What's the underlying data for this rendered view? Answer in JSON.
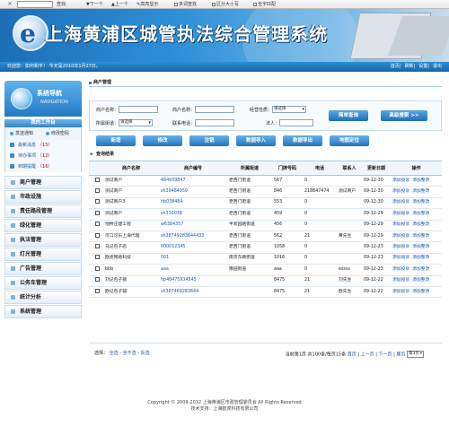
{
  "findbar": {
    "close_glyph": "×",
    "find_label": "查找:",
    "next_label": "下一个",
    "prev_label": "上一个",
    "highlight_label": "高亮显示",
    "multi_label": "多词查找",
    "case_label": "区分大小写",
    "whole_label": "全字匹配"
  },
  "header": {
    "logo_glyph": "e",
    "title": "上海黄浦区城管执法综合管理系统",
    "welcome": "欢迎您：如何和平！ 今天是2010年1月27日。",
    "links": [
      "首页",
      "刷新",
      "设置",
      "退出"
    ]
  },
  "sidebar": {
    "nav_title": "系统导航",
    "nav_subtitle": "NAVIGATION",
    "mywork_title": "我的工作台",
    "shortcuts": [
      "发送通知",
      "修改密码"
    ],
    "tasks": [
      {
        "label": "最新消息",
        "count": "（15）"
      },
      {
        "label": "待办事项",
        "count": "（12）"
      },
      {
        "label": "到期提醒",
        "count": "（16）"
      }
    ],
    "modules": [
      "商户管理",
      "市政设施",
      "责任路段管理",
      "绿化管理",
      "执法管理",
      "灯光管理",
      "广告管理",
      "公务车管理",
      "统计分析",
      "系统管理"
    ]
  },
  "main": {
    "breadcrumb": "商户管理",
    "search": {
      "merchant_name_label": "商户名称：",
      "merchant_no_label": "商户名称：",
      "street_label": "经营性质：",
      "street_value": "请选择",
      "street2_label": "所属街道：",
      "street2_value": "请选择",
      "contact_phone_label": "联系电话：",
      "legal_label": "法人：",
      "query_btn": "简单查询",
      "advanced_btn": "高级搜索 >>"
    },
    "toolbar": [
      "新增",
      "修改",
      "注销",
      "数据导入",
      "数据导出",
      "地图定位"
    ],
    "result_title": "查询结果",
    "columns": [
      "",
      "商户名称",
      "商户编号",
      "所属街道",
      "门牌号码",
      "电话",
      "联系人",
      "更新日期",
      "操作"
    ],
    "op_labels": [
      "添加投诉",
      "添加整改"
    ],
    "rows": [
      [
        "测试商户",
        "484939847",
        "老西门街道",
        "567",
        "0",
        "",
        "09-12-30"
      ],
      [
        "测试商户",
        "sh30484959",
        "老西门街道",
        "846",
        "218847474",
        "测试商户",
        "09-12-30"
      ],
      [
        "测试商户3",
        "hb038484",
        "老西门街道",
        "553",
        "0",
        "",
        "09-12-30"
      ],
      [
        "测试商户",
        "sh330038",
        "老西门街道",
        "459",
        "0",
        "",
        "09-12-29"
      ],
      [
        "地桥庄建工程",
        "w6384357",
        "半淞园路街道",
        "456",
        "0",
        "",
        "09-12-29"
      ],
      [
        "可口可乐上海代理",
        "sh38749283644433",
        "老西门街道",
        "562",
        "21",
        "黄先生",
        "09-12-29"
      ],
      [
        "马记包子店",
        "000012345",
        "老西门街道",
        "1058",
        "0",
        "",
        "09-12-23"
      ],
      [
        "欧虎网络科技",
        "001",
        "南京东路街道",
        "1016",
        "0",
        "",
        "09-12-23"
      ],
      [
        "bbb",
        "aaa",
        "豫园街道",
        "aaa",
        "0",
        "essss",
        "09-12-23"
      ],
      [
        "刘记包子铺",
        "hp48475934545",
        "",
        "8475",
        "21",
        "刘先生",
        "09-12-22"
      ],
      [
        "欧记包子铺",
        "sh387469283644",
        "",
        "8475",
        "21",
        "欧先生",
        "09-12-22"
      ]
    ],
    "footer": {
      "select_label": "选择：",
      "select_all": "全选",
      "select_none": "全不选",
      "select_invert": "反选",
      "pager_text": "当前第1页 共100条/每页15条",
      "first": "首页",
      "prev": "上一页",
      "next": "下一页",
      "last": "尾页",
      "jump_value": "第3页"
    }
  },
  "copyright": {
    "line1": "Copyright © 2009-2012 上海黄浦区市政管理委员会  All Rights Reserved",
    "line2": "技术支持：上海欧虎科技有限公司"
  }
}
